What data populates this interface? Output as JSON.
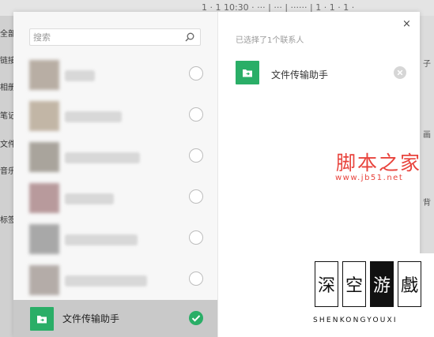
{
  "background": {
    "top_text": "1 · 1 10:30  ·  ··· | ··· | ······ | 1 · 1 · 1 ·",
    "side_items": [
      "全部",
      "链接",
      "相册",
      "笔记",
      "文件",
      "音乐",
      "标签"
    ],
    "right_items": [
      "子",
      "画",
      "背"
    ]
  },
  "dialog": {
    "search": {
      "placeholder": "搜索"
    },
    "contacts": [
      {
        "name": "",
        "avatar_color": "#b8aea4"
      },
      {
        "name": "",
        "avatar_color": "#c2b6a6"
      },
      {
        "name": "",
        "avatar_color": "#a9a49c"
      },
      {
        "name": "",
        "avatar_color": "#b89a9c"
      },
      {
        "name": "",
        "avatar_color": "#a8a8a8"
      },
      {
        "name": "",
        "avatar_color": "#b4aca8"
      }
    ],
    "selected_contact": {
      "name": "文件传输助手",
      "checked": true
    },
    "close_label": "×",
    "right_pane": {
      "selected_count_text": "已选择了1个联系人",
      "chosen": {
        "name": "文件传输助手"
      }
    }
  },
  "watermark": {
    "title": "脚本之家",
    "url": "www.jb51.net",
    "logo_chars": [
      "深",
      "空",
      "游",
      "戲"
    ],
    "logo_sub": "SHENKONGYOUXI"
  },
  "colors": {
    "accent": "#2aae67",
    "watermark_red": "#e8433c"
  }
}
